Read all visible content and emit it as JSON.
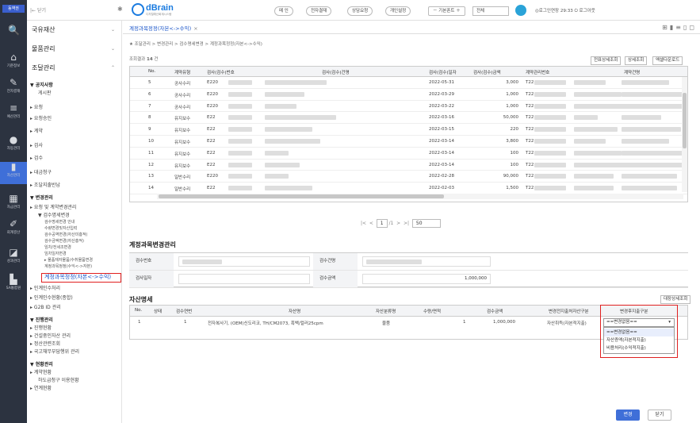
{
  "app": {
    "logo": "동역권",
    "brand": "dBrain",
    "brand_sub": "디지털예산회계시스템"
  },
  "rail": [
    {
      "icon": "🔍",
      "label": ""
    },
    {
      "icon": "⌂",
      "label": "기준정보"
    },
    {
      "icon": "✎",
      "label": "전자결재"
    },
    {
      "icon": "≡",
      "label": "예산관리"
    },
    {
      "icon": "●",
      "label": "자동관리"
    },
    {
      "icon": "▮",
      "label": "자산관리"
    },
    {
      "icon": "▦",
      "label": "자금관리"
    },
    {
      "icon": "✐",
      "label": "회계결산"
    },
    {
      "icon": "◪",
      "label": "성과관리"
    },
    {
      "icon": "▙",
      "label": "SA통합원"
    }
  ],
  "topbar": {
    "close": "|← 닫기",
    "buttons": [
      "메 인",
      "전자결재",
      "상담요청",
      "개인설정"
    ],
    "basic": "－ 기본폰트 ＋",
    "combo": "전체",
    "user": "◎로그인연장  29:33  ⏻ 로그아웃"
  },
  "menu": {
    "sections": [
      {
        "label": "국유재산"
      },
      {
        "label": "물품관리"
      },
      {
        "label": "조달관리"
      }
    ],
    "items": [
      {
        "t": "▼ 공지사항",
        "c": "l1b"
      },
      {
        "t": "게시판",
        "c": "l2"
      },
      {
        "t": "▸ 요청",
        "c": "l1"
      },
      {
        "t": "▸ 요청승인",
        "c": "l1"
      },
      {
        "t": "▸ 계약",
        "c": "l1"
      },
      {
        "t": "▸ 검사",
        "c": "l1"
      },
      {
        "t": "▸ 검수",
        "c": "l1"
      },
      {
        "t": "▸ 대금청구",
        "c": "l1"
      },
      {
        "t": "▸ 조달지출반납",
        "c": "l1"
      },
      {
        "t": "▼ 변경관리",
        "c": "l1b"
      },
      {
        "t": "▸ 요청 및 계약변경관리",
        "c": "l1"
      },
      {
        "t": "▼ 검수명세변경",
        "c": "l2"
      },
      {
        "t": "검수명세변경 안내",
        "c": "l3"
      },
      {
        "t": "수량변경및자산입력",
        "c": "l3"
      },
      {
        "t": "검수공역변경(자산미흥적)",
        "c": "l3"
      },
      {
        "t": "검수금액변경(자산흥적)",
        "c": "l3"
      },
      {
        "t": "임차/전세조변경",
        "c": "l3"
      },
      {
        "t": "임차일자변경",
        "c": "l3"
      },
      {
        "t": "▸ 물품재자물품/수취물품변경",
        "c": "l3"
      },
      {
        "t": "계정과목정정(수익<->자본)",
        "c": "l3"
      },
      {
        "t": "계정과목정정(자본<->수익)",
        "c": "hl"
      },
      {
        "t": "▸ 인계인수처리",
        "c": "l1"
      },
      {
        "t": "▸ 인계인수현황(종합)",
        "c": "l1"
      },
      {
        "t": "▸ G2B ID 관리",
        "c": "l1"
      },
      {
        "t": "▼ 진행관리",
        "c": "l1b"
      },
      {
        "t": "▸ 진행현황",
        "c": "l1"
      },
      {
        "t": "▸ 건설중인자산 관리",
        "c": "l1"
      },
      {
        "t": "▸ 정산관련조회",
        "c": "l1"
      },
      {
        "t": "▸ 국고채무부담행위 관리",
        "c": "l1"
      },
      {
        "t": "▼ 현황관리",
        "c": "l1b"
      },
      {
        "t": "▸ 계약현황",
        "c": "l1"
      },
      {
        "t": "하도급청구 이용현황",
        "c": "l2"
      },
      {
        "t": "▸ 연계현황",
        "c": "l1"
      }
    ]
  },
  "tab": {
    "label": "계정과목정정(자본<->수익)",
    "close": "×"
  },
  "breadcrumb": "★ 조달관리 > 변경관리 > 검수명세변경 > 계정과목정정(자본<->수익)",
  "list": {
    "count_label": "조회결과",
    "count": "14",
    "count_unit": "건",
    "buttons": [
      "전표상세조회",
      "상세조회",
      "엑셀다운로드"
    ],
    "headers": [
      "No.",
      "계약유형",
      "검사(검수)번호",
      "검사(검수)건명",
      "검사(검수)일자",
      "검사(검수)금액",
      "계약관리번호",
      "계약건명"
    ],
    "rows": [
      {
        "no": "5",
        "type": "공사수리",
        "num": "E220",
        "date": "2022-05-31",
        "amt": "3,000",
        "ctr": "T22"
      },
      {
        "no": "6",
        "type": "공사수리",
        "num": "E220",
        "date": "2022-03-29",
        "amt": "1,000",
        "ctr": "T22"
      },
      {
        "no": "7",
        "type": "공사수리",
        "num": "E220",
        "date": "2022-03-22",
        "amt": "1,000",
        "ctr": "T22"
      },
      {
        "no": "8",
        "type": "유지보수",
        "num": "E22",
        "date": "2022-03-16",
        "amt": "50,000",
        "ctr": "T22"
      },
      {
        "no": "9",
        "type": "유지보수",
        "num": "E22",
        "date": "2022-03-15",
        "amt": "220",
        "ctr": "T22"
      },
      {
        "no": "10",
        "type": "유지보수",
        "num": "E22",
        "date": "2022-03-14",
        "amt": "3,800",
        "ctr": "T22"
      },
      {
        "no": "11",
        "type": "유지보수",
        "num": "E22",
        "date": "2022-03-14",
        "amt": "100",
        "ctr": "T22"
      },
      {
        "no": "12",
        "type": "유지보수",
        "num": "E22",
        "date": "2022-03-14",
        "amt": "100",
        "ctr": "T22"
      },
      {
        "no": "13",
        "type": "일반수리",
        "num": "E220",
        "date": "2022-02-28",
        "amt": "90,000",
        "ctr": "T22"
      },
      {
        "no": "14",
        "type": "일반수리",
        "num": "E22",
        "date": "2022-02-03",
        "amt": "1,500",
        "ctr": "T22"
      }
    ]
  },
  "pager": {
    "page": "1",
    "total": "/1",
    "size": "50"
  },
  "change": {
    "title": "계정과목변경관리",
    "f1": "검수번호",
    "f2": "검수건명",
    "f3": "검사일자",
    "f4": "검수금액",
    "amount": "1,000,000"
  },
  "detail": {
    "title": "자산명세",
    "btn": "대장상세조회",
    "headers": [
      "No.",
      "상태",
      "검수연번",
      "자산명",
      "자산분류명",
      "수량/면적",
      "검수금액",
      "변경전지출처자산구분",
      "변경후지출구분"
    ],
    "row": {
      "no": "1",
      "seq": "1",
      "name": "전자복사기, (OEM)신도리코, TH/CM2073, 흑백/컬러25cpm",
      "cls": "물품",
      "qty": "1",
      "amt": "1,000,000",
      "before": "자산취득(자본적지출)"
    },
    "select": "==변경없음==",
    "options": [
      "==변경없음==",
      "자산증액(자본적지출)",
      "비용처리(수익적지출)"
    ]
  },
  "footer": {
    "change": "변경",
    "close": "닫기"
  }
}
